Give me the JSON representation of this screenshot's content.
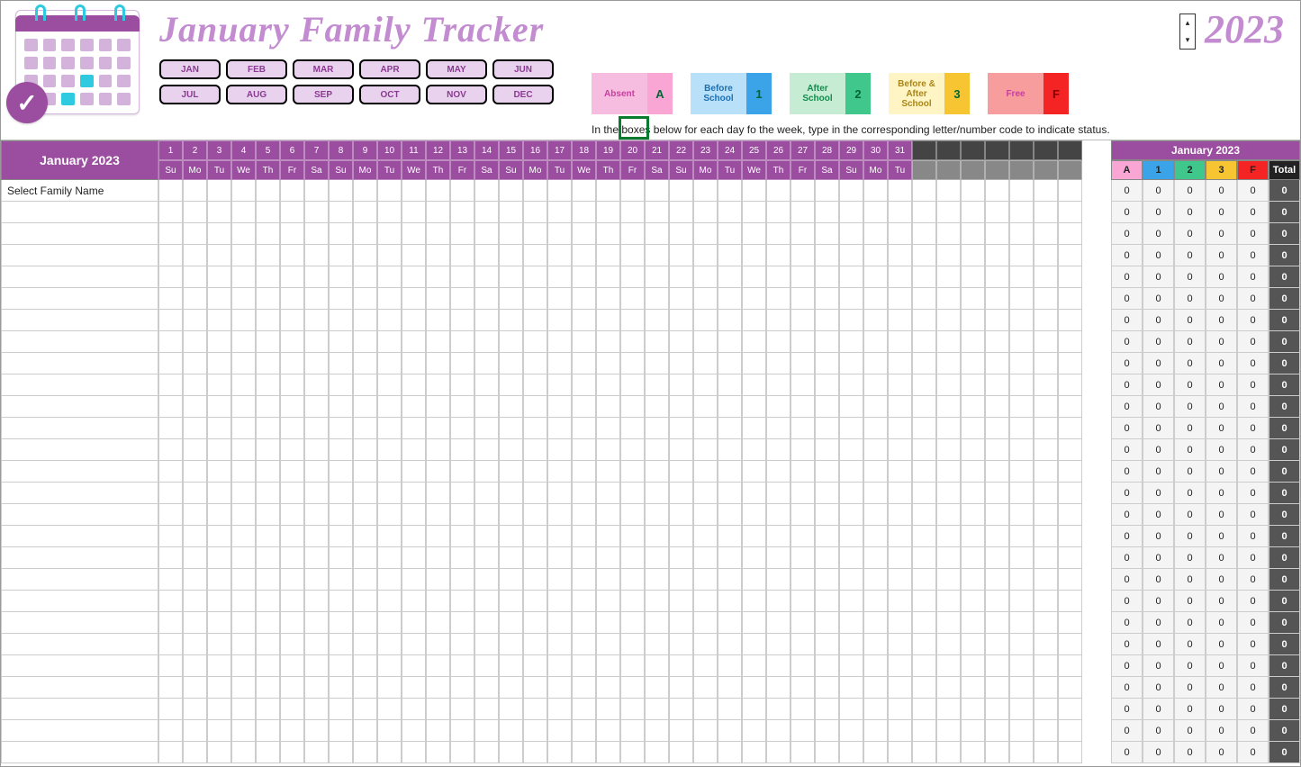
{
  "header": {
    "title": "January Family Tracker",
    "year": "2023",
    "months": [
      "JAN",
      "FEB",
      "MAR",
      "APR",
      "MAY",
      "JUN",
      "JUL",
      "AUG",
      "SEP",
      "OCT",
      "NOV",
      "DEC"
    ],
    "instruction": "In the boxes below for each day fo the week, type in the corresponding letter/number code to indicate status."
  },
  "legend": [
    {
      "label": "Absent",
      "code": "A",
      "bg": "#f7bde0",
      "codeBg": "#f9a6d4",
      "color": "#c73f9e"
    },
    {
      "label": "Before School",
      "code": "1",
      "bg": "#b8e0f9",
      "codeBg": "#3ba3e8",
      "color": "#1e6fb0"
    },
    {
      "label": "After School",
      "code": "2",
      "bg": "#c6edd4",
      "codeBg": "#3fc78c",
      "color": "#168a4e"
    },
    {
      "label": "Before & After School",
      "code": "3",
      "bg": "#fff4c4",
      "codeBg": "#f7c531",
      "color": "#a8861a"
    },
    {
      "label": "Free",
      "code": "F",
      "bg": "#f79d9d",
      "codeBg": "#f42424",
      "color": "#c73f9e"
    }
  ],
  "calendar": {
    "monthLabel": "January 2023",
    "days": [
      1,
      2,
      3,
      4,
      5,
      6,
      7,
      8,
      9,
      10,
      11,
      12,
      13,
      14,
      15,
      16,
      17,
      18,
      19,
      20,
      21,
      22,
      23,
      24,
      25,
      26,
      27,
      28,
      29,
      30,
      31
    ],
    "dow": [
      "Su",
      "Mo",
      "Tu",
      "We",
      "Th",
      "Fr",
      "Sa",
      "Su",
      "Mo",
      "Tu",
      "We",
      "Th",
      "Fr",
      "Sa",
      "Su",
      "Mo",
      "Tu",
      "We",
      "Th",
      "Fr",
      "Sa",
      "Su",
      "Mo",
      "Tu",
      "We",
      "Th",
      "Fr",
      "Sa",
      "Su",
      "Mo",
      "Tu"
    ],
    "extraCols": 7
  },
  "rows": {
    "firstLabel": "Select Family Name",
    "count": 27
  },
  "summary": {
    "title": "January 2023",
    "columns": [
      {
        "label": "A",
        "bg": "#f9a6d4"
      },
      {
        "label": "1",
        "bg": "#3ba3e8"
      },
      {
        "label": "2",
        "bg": "#3fc78c"
      },
      {
        "label": "3",
        "bg": "#f7c531"
      },
      {
        "label": "F",
        "bg": "#f42424"
      },
      {
        "label": "Total",
        "bg": "#222",
        "color": "#fff"
      }
    ],
    "zero": "0"
  }
}
